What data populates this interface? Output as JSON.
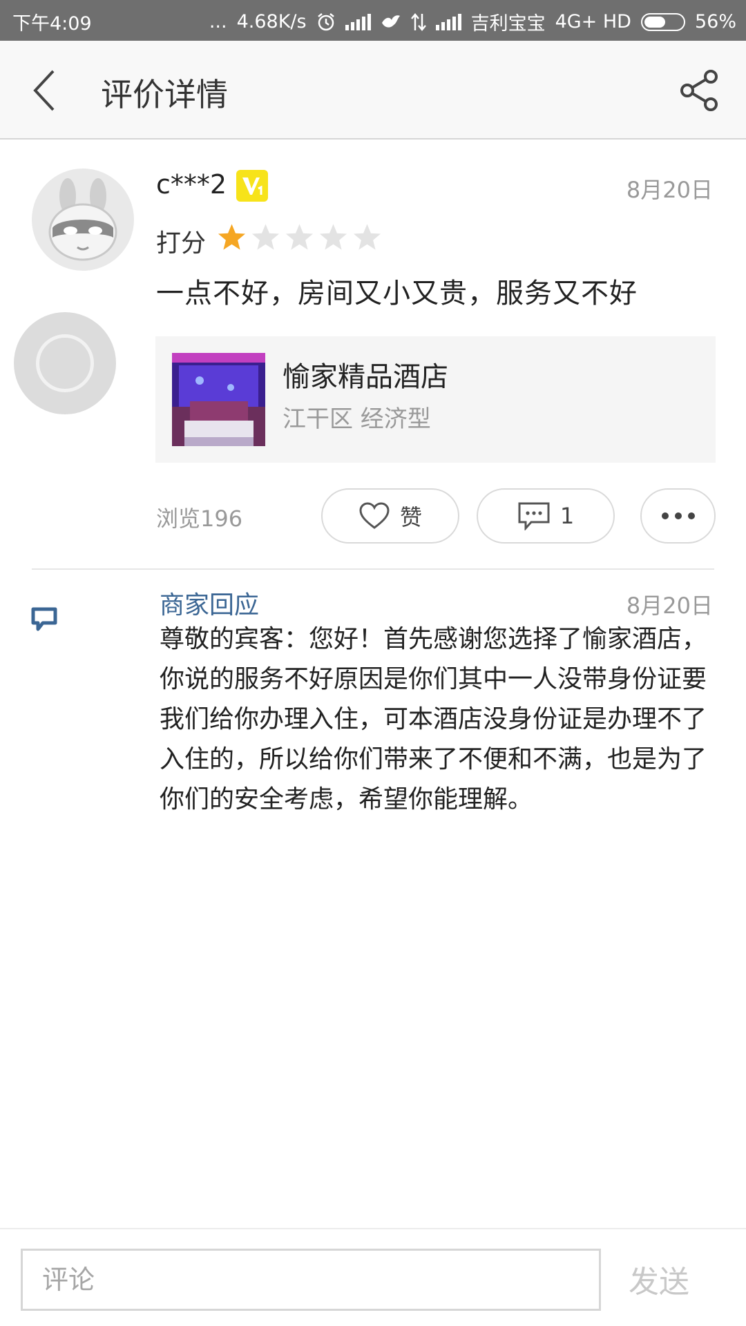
{
  "status_bar": {
    "time": "下午4:09",
    "dots": "...",
    "net_speed": "4.68K/s",
    "carrier": "吉利宝宝",
    "network": "4G+ HD",
    "battery": "56%",
    "battery_level": 0.56,
    "icons": [
      "alarm-icon",
      "signal-icon",
      "bird-icon",
      "data-arrows-icon",
      "signal-icon",
      "battery-icon"
    ]
  },
  "header": {
    "title": "评价详情",
    "back_icon": "back-chevron-icon",
    "share_icon": "share-icon"
  },
  "review": {
    "username": "c***2",
    "badge": "V1",
    "date": "8月20日",
    "score_label": "打分",
    "rating": 1,
    "rating_max": 5,
    "text": "一点不好，房间又小又贵，服务又不好",
    "hotel": {
      "name": "愉家精品酒店",
      "meta": "江干区  经济型"
    },
    "views": "浏览196",
    "like_label": "赞",
    "comment_count": "1"
  },
  "merchant_reply": {
    "label": "商家回应",
    "date": "8月20日",
    "text": "尊敬的宾客：您好！首先感谢您选择了愉家酒店，你说的服务不好原因是你们其中一人没带身份证要我们给你办理入住，可本酒店没身份证是办理不了入住的，所以给你们带来了不便和不满，也是为了你们的安全考虑，希望你能理解。"
  },
  "bottom_bar": {
    "comment_placeholder": "评论",
    "send_label": "发送"
  },
  "colors": {
    "status_bar": "#6f6f6f",
    "star_active": "#f5a623",
    "star_inactive": "#e3e3e3",
    "badge": "#f7e31a",
    "reply_label": "#3b6694"
  }
}
